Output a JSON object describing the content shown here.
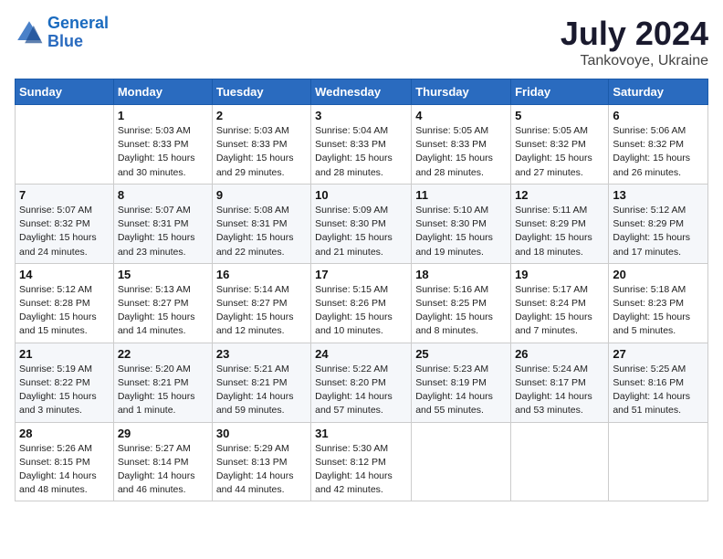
{
  "header": {
    "logo_line1": "General",
    "logo_line2": "Blue",
    "month": "July 2024",
    "location": "Tankovoye, Ukraine"
  },
  "weekdays": [
    "Sunday",
    "Monday",
    "Tuesday",
    "Wednesday",
    "Thursday",
    "Friday",
    "Saturday"
  ],
  "weeks": [
    [
      {
        "day": "",
        "info": ""
      },
      {
        "day": "1",
        "info": "Sunrise: 5:03 AM\nSunset: 8:33 PM\nDaylight: 15 hours\nand 30 minutes."
      },
      {
        "day": "2",
        "info": "Sunrise: 5:03 AM\nSunset: 8:33 PM\nDaylight: 15 hours\nand 29 minutes."
      },
      {
        "day": "3",
        "info": "Sunrise: 5:04 AM\nSunset: 8:33 PM\nDaylight: 15 hours\nand 28 minutes."
      },
      {
        "day": "4",
        "info": "Sunrise: 5:05 AM\nSunset: 8:33 PM\nDaylight: 15 hours\nand 28 minutes."
      },
      {
        "day": "5",
        "info": "Sunrise: 5:05 AM\nSunset: 8:32 PM\nDaylight: 15 hours\nand 27 minutes."
      },
      {
        "day": "6",
        "info": "Sunrise: 5:06 AM\nSunset: 8:32 PM\nDaylight: 15 hours\nand 26 minutes."
      }
    ],
    [
      {
        "day": "7",
        "info": "Sunrise: 5:07 AM\nSunset: 8:32 PM\nDaylight: 15 hours\nand 24 minutes."
      },
      {
        "day": "8",
        "info": "Sunrise: 5:07 AM\nSunset: 8:31 PM\nDaylight: 15 hours\nand 23 minutes."
      },
      {
        "day": "9",
        "info": "Sunrise: 5:08 AM\nSunset: 8:31 PM\nDaylight: 15 hours\nand 22 minutes."
      },
      {
        "day": "10",
        "info": "Sunrise: 5:09 AM\nSunset: 8:30 PM\nDaylight: 15 hours\nand 21 minutes."
      },
      {
        "day": "11",
        "info": "Sunrise: 5:10 AM\nSunset: 8:30 PM\nDaylight: 15 hours\nand 19 minutes."
      },
      {
        "day": "12",
        "info": "Sunrise: 5:11 AM\nSunset: 8:29 PM\nDaylight: 15 hours\nand 18 minutes."
      },
      {
        "day": "13",
        "info": "Sunrise: 5:12 AM\nSunset: 8:29 PM\nDaylight: 15 hours\nand 17 minutes."
      }
    ],
    [
      {
        "day": "14",
        "info": "Sunrise: 5:12 AM\nSunset: 8:28 PM\nDaylight: 15 hours\nand 15 minutes."
      },
      {
        "day": "15",
        "info": "Sunrise: 5:13 AM\nSunset: 8:27 PM\nDaylight: 15 hours\nand 14 minutes."
      },
      {
        "day": "16",
        "info": "Sunrise: 5:14 AM\nSunset: 8:27 PM\nDaylight: 15 hours\nand 12 minutes."
      },
      {
        "day": "17",
        "info": "Sunrise: 5:15 AM\nSunset: 8:26 PM\nDaylight: 15 hours\nand 10 minutes."
      },
      {
        "day": "18",
        "info": "Sunrise: 5:16 AM\nSunset: 8:25 PM\nDaylight: 15 hours\nand 8 minutes."
      },
      {
        "day": "19",
        "info": "Sunrise: 5:17 AM\nSunset: 8:24 PM\nDaylight: 15 hours\nand 7 minutes."
      },
      {
        "day": "20",
        "info": "Sunrise: 5:18 AM\nSunset: 8:23 PM\nDaylight: 15 hours\nand 5 minutes."
      }
    ],
    [
      {
        "day": "21",
        "info": "Sunrise: 5:19 AM\nSunset: 8:22 PM\nDaylight: 15 hours\nand 3 minutes."
      },
      {
        "day": "22",
        "info": "Sunrise: 5:20 AM\nSunset: 8:21 PM\nDaylight: 15 hours\nand 1 minute."
      },
      {
        "day": "23",
        "info": "Sunrise: 5:21 AM\nSunset: 8:21 PM\nDaylight: 14 hours\nand 59 minutes."
      },
      {
        "day": "24",
        "info": "Sunrise: 5:22 AM\nSunset: 8:20 PM\nDaylight: 14 hours\nand 57 minutes."
      },
      {
        "day": "25",
        "info": "Sunrise: 5:23 AM\nSunset: 8:19 PM\nDaylight: 14 hours\nand 55 minutes."
      },
      {
        "day": "26",
        "info": "Sunrise: 5:24 AM\nSunset: 8:17 PM\nDaylight: 14 hours\nand 53 minutes."
      },
      {
        "day": "27",
        "info": "Sunrise: 5:25 AM\nSunset: 8:16 PM\nDaylight: 14 hours\nand 51 minutes."
      }
    ],
    [
      {
        "day": "28",
        "info": "Sunrise: 5:26 AM\nSunset: 8:15 PM\nDaylight: 14 hours\nand 48 minutes."
      },
      {
        "day": "29",
        "info": "Sunrise: 5:27 AM\nSunset: 8:14 PM\nDaylight: 14 hours\nand 46 minutes."
      },
      {
        "day": "30",
        "info": "Sunrise: 5:29 AM\nSunset: 8:13 PM\nDaylight: 14 hours\nand 44 minutes."
      },
      {
        "day": "31",
        "info": "Sunrise: 5:30 AM\nSunset: 8:12 PM\nDaylight: 14 hours\nand 42 minutes."
      },
      {
        "day": "",
        "info": ""
      },
      {
        "day": "",
        "info": ""
      },
      {
        "day": "",
        "info": ""
      }
    ]
  ]
}
